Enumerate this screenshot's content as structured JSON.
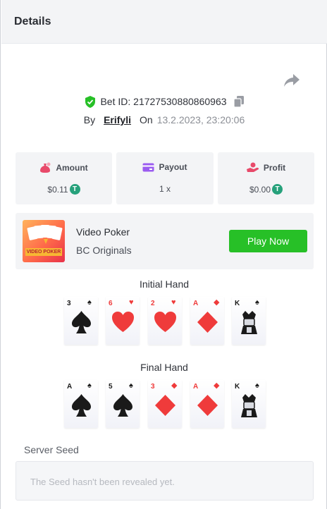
{
  "header": {
    "title": "Details"
  },
  "bet": {
    "id_label": "Bet ID: 21727530880860963",
    "by_label": "By",
    "user": "Erifyli",
    "on_label": "On",
    "date": "13.2.2023, 23:20:06"
  },
  "stats": {
    "amount": {
      "label": "Amount",
      "value": "$0.11",
      "icon": "money-bag-icon"
    },
    "payout": {
      "label": "Payout",
      "value": "1 x",
      "icon": "card-icon"
    },
    "profit": {
      "label": "Profit",
      "value": "$0.00",
      "icon": "hand-coin-icon"
    },
    "coin_symbol": "T"
  },
  "game": {
    "title": "Video Poker",
    "provider": "BC Originals",
    "thumb_label": "VIDEO POKER",
    "play_label": "Play Now"
  },
  "initial_hand": {
    "title": "Initial Hand",
    "cards": [
      {
        "rank": "3",
        "suit": "spade",
        "color": "black"
      },
      {
        "rank": "6",
        "suit": "heart",
        "color": "red"
      },
      {
        "rank": "2",
        "suit": "heart",
        "color": "red"
      },
      {
        "rank": "A",
        "suit": "diamond",
        "color": "red"
      },
      {
        "rank": "K",
        "suit": "spade",
        "color": "black"
      }
    ]
  },
  "final_hand": {
    "title": "Final Hand",
    "cards": [
      {
        "rank": "A",
        "suit": "spade",
        "color": "black"
      },
      {
        "rank": "5",
        "suit": "spade",
        "color": "black"
      },
      {
        "rank": "3",
        "suit": "diamond",
        "color": "red"
      },
      {
        "rank": "A",
        "suit": "diamond",
        "color": "red"
      },
      {
        "rank": "K",
        "suit": "spade",
        "color": "black"
      }
    ]
  },
  "seed": {
    "label": "Server Seed",
    "placeholder": "The Seed hasn't been revealed yet."
  },
  "colors": {
    "accent_green": "#27c027",
    "tether": "#26a17b",
    "red_suit": "#ef3b3b"
  }
}
